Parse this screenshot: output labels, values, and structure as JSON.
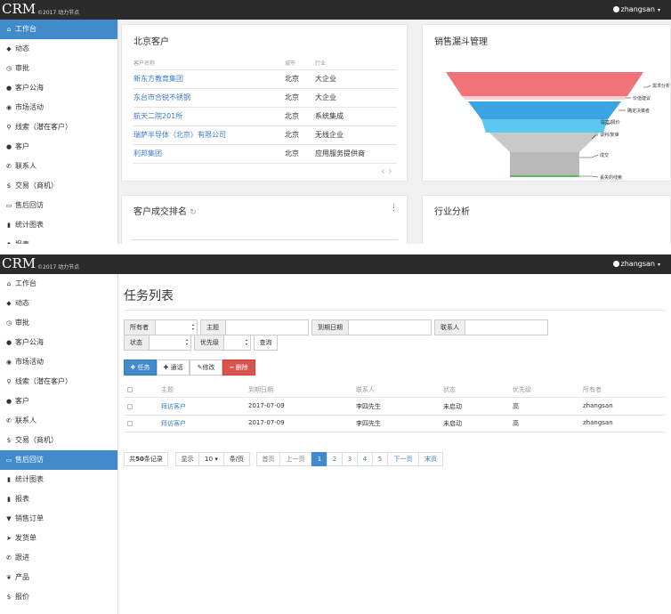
{
  "app": {
    "logo": "CRM",
    "copyright": "©2017 动力节点",
    "user": "zhangsan"
  },
  "sidebar1": [
    {
      "label": "工作台",
      "icon": "home-icon",
      "glyph": "⌂",
      "active": true
    },
    {
      "label": "动态",
      "icon": "tag-icon",
      "glyph": "◆",
      "active": false
    },
    {
      "label": "审批",
      "icon": "clock-icon",
      "glyph": "◷",
      "active": false
    },
    {
      "label": "客户公海",
      "icon": "users-icon",
      "glyph": "●",
      "active": false
    },
    {
      "label": "市场活动",
      "icon": "play-icon",
      "glyph": "◉",
      "active": false
    },
    {
      "label": "线索（潜在客户）",
      "icon": "search-icon",
      "glyph": "⚲",
      "active": false
    },
    {
      "label": "客户",
      "icon": "user-icon",
      "glyph": "●",
      "active": false
    },
    {
      "label": "联系人",
      "icon": "phone-icon",
      "glyph": "✆",
      "active": false
    },
    {
      "label": "交易（商机）",
      "icon": "dollar-icon",
      "glyph": "$",
      "active": false
    },
    {
      "label": "售后回访",
      "icon": "inbox-icon",
      "glyph": "▭",
      "active": false
    },
    {
      "label": "统计图表",
      "icon": "stats-icon",
      "glyph": "▮",
      "active": false
    },
    {
      "label": "报表",
      "icon": "file-icon",
      "glyph": "▮",
      "active": false
    }
  ],
  "sidebar2": [
    {
      "label": "工作台",
      "icon": "home-icon",
      "glyph": "⌂",
      "active": false
    },
    {
      "label": "动态",
      "icon": "tag-icon",
      "glyph": "◆",
      "active": false
    },
    {
      "label": "审批",
      "icon": "clock-icon",
      "glyph": "◷",
      "active": false
    },
    {
      "label": "客户公海",
      "icon": "users-icon",
      "glyph": "●",
      "active": false
    },
    {
      "label": "市场活动",
      "icon": "play-icon",
      "glyph": "◉",
      "active": false
    },
    {
      "label": "线索（潜在客户）",
      "icon": "search-icon",
      "glyph": "⚲",
      "active": false
    },
    {
      "label": "客户",
      "icon": "user-icon",
      "glyph": "●",
      "active": false
    },
    {
      "label": "联系人",
      "icon": "phone-icon",
      "glyph": "✆",
      "active": false
    },
    {
      "label": "交易（商机）",
      "icon": "dollar-icon",
      "glyph": "$",
      "active": false
    },
    {
      "label": "售后回访",
      "icon": "inbox-icon",
      "glyph": "▭",
      "active": true
    },
    {
      "label": "统计图表",
      "icon": "stats-icon",
      "glyph": "▮",
      "active": false
    },
    {
      "label": "报表",
      "icon": "file-icon",
      "glyph": "▮",
      "active": false
    },
    {
      "label": "销售订单",
      "icon": "cart-icon",
      "glyph": "▼",
      "active": false
    },
    {
      "label": "发货单",
      "icon": "send-icon",
      "glyph": "➤",
      "active": false
    },
    {
      "label": "跟进",
      "icon": "phone-icon",
      "glyph": "✆",
      "active": false
    },
    {
      "label": "产品",
      "icon": "leaf-icon",
      "glyph": "❦",
      "active": false
    },
    {
      "label": "报价",
      "icon": "dollar-icon",
      "glyph": "$",
      "active": false
    }
  ],
  "beijing": {
    "title": "北京客户",
    "headers": [
      "客户名称",
      "城市",
      "行业"
    ],
    "rows": [
      {
        "name": "新东方教育集团",
        "city": "北京",
        "industry": "大企业"
      },
      {
        "name": "东台市合锐不锈钢",
        "city": "北京",
        "industry": "大企业"
      },
      {
        "name": "航天二院201所",
        "city": "北京",
        "industry": "系统集成"
      },
      {
        "name": "瑞萨半导体（北京）有限公司",
        "city": "北京",
        "industry": "无线企业"
      },
      {
        "name": "利邦集团",
        "city": "北京",
        "industry": "应用服务提供商"
      }
    ]
  },
  "funnel": {
    "title": "销售漏斗管理",
    "stages": [
      "需求分析",
      "价值建议",
      "确定决策者",
      "提案/报价",
      "谈判/复审",
      "成交",
      "丢失的线索"
    ],
    "colors": {
      "stage1": "#f0737a",
      "stage2": "#fbd0d2",
      "stage3": "#3aa3e3",
      "stage4": "#5cc7f0",
      "stage5": "#c9c9c9",
      "stage6": "#b9b9b9",
      "stage7": "#5fb760"
    }
  },
  "ranking": {
    "title": "客户成交排名"
  },
  "industry": {
    "title": "行业分析"
  },
  "tasks": {
    "title": "任务列表",
    "filters": {
      "owner": "所有者",
      "subject": "主题",
      "due": "到期日期",
      "contact": "联系人",
      "status": "状态",
      "priority": "优先级",
      "query": "查询"
    },
    "actions": {
      "add": "任务",
      "call": "通话",
      "edit": "修改",
      "delete": "删除"
    },
    "headers": [
      "主题",
      "到期日期",
      "联系人",
      "状态",
      "优先级",
      "所有者"
    ],
    "rows": [
      {
        "subject": "拜访客户",
        "due": "2017-07-09",
        "contact": "李四先生",
        "status": "未启动",
        "priority": "高",
        "owner": "zhangsan"
      },
      {
        "subject": "拜访客户",
        "due": "2017-07-09",
        "contact": "李四先生",
        "status": "未启动",
        "priority": "高",
        "owner": "zhangsan"
      }
    ],
    "pagination": {
      "total_prefix": "共",
      "total_count": "50",
      "total_suffix": "条记录",
      "show": "显示",
      "page_size": "10",
      "per_page": "条/页",
      "first": "首页",
      "prev": "上一页",
      "pages": [
        "1",
        "2",
        "3",
        "4",
        "5"
      ],
      "current": "1",
      "next": "下一页",
      "last": "末页"
    }
  }
}
